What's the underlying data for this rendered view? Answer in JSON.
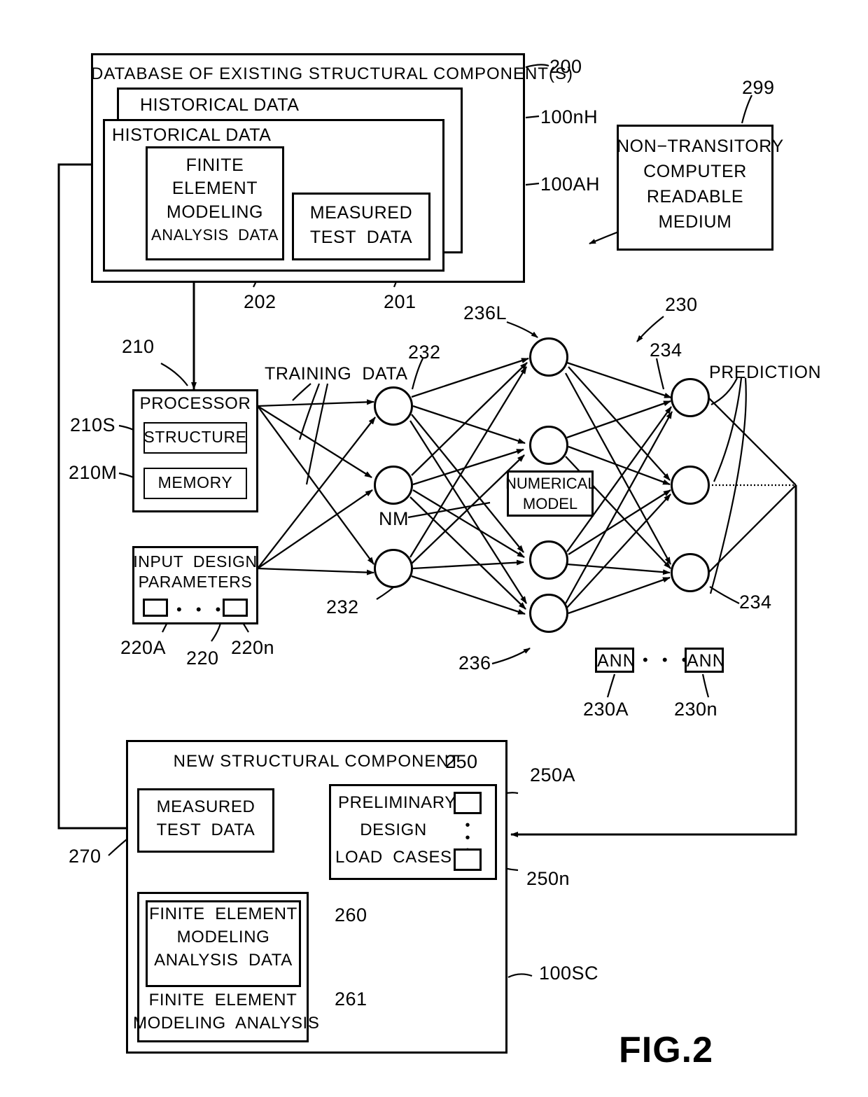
{
  "figure": {
    "title": "FIG.2",
    "type": "patent-flow-diagram"
  },
  "database": {
    "title": "DATABASE OF EXISTING STRUCTURAL COMPONENT(S)",
    "ref": "200",
    "historical_outer": {
      "title": "HISTORICAL DATA",
      "ref": "100nH"
    },
    "historical_inner": {
      "title": "HISTORICAL DATA",
      "ref": "100AH"
    },
    "fem_box": {
      "line1": "FINITE",
      "line2": "ELEMENT",
      "line3": "MODELING",
      "line4": "ANALYSIS  DATA",
      "ref": "202"
    },
    "measured_box": {
      "line1": "MEASURED",
      "line2": "TEST  DATA",
      "ref": "201"
    }
  },
  "medium": {
    "line1": "NON−TRANSITORY",
    "line2": "COMPUTER",
    "line3": "READABLE",
    "line4": "MEDIUM",
    "ref": "299"
  },
  "processor": {
    "title": "PROCESSOR",
    "ref": "210",
    "structure": {
      "label": "STRUCTURE",
      "ref": "210S"
    },
    "memory": {
      "label": "MEMORY",
      "ref": "210M"
    }
  },
  "input_params": {
    "line1": "INPUT  DESIGN",
    "line2": "PARAMETERS",
    "ref": "220",
    "first_ref": "220A",
    "last_ref": "220n",
    "ellipsis": "• • •"
  },
  "network": {
    "ref": "230",
    "training_data_label": "TRAINING  DATA",
    "prediction_label": "PREDICTION",
    "input_layer_ref": "232",
    "input_layer_ref2": "232",
    "hidden_layer_ref": "236",
    "hidden_layer_top_ref": "236L",
    "output_layer_ref": "234",
    "output_layer_ref2": "234",
    "numerical_model": {
      "line1": "NUMERICAL",
      "line2": "MODEL",
      "ref": "NM"
    },
    "ann_first": {
      "label": "ANN",
      "ref": "230A"
    },
    "ann_last": {
      "label": "ANN",
      "ref": "230n"
    },
    "ann_ellipsis": "• • •",
    "input_node_count": 3,
    "hidden_node_count": 4,
    "output_node_count": 3
  },
  "new_component": {
    "title": "NEW STRUCTURAL COMPONENT",
    "ref": "100SC",
    "measured_test_data": {
      "line1": "MEASURED",
      "line2": "TEST  DATA",
      "ref": "270"
    },
    "fem_analysis": {
      "inner_line1": "FINITE  ELEMENT",
      "inner_line2": "MODELING",
      "inner_line3": "ANALYSIS  DATA",
      "outer_line1": "FINITE  ELEMENT",
      "outer_line2": "MODELING  ANALYSIS",
      "inner_ref": "260",
      "outer_ref": "261"
    },
    "preliminary": {
      "line1": "PRELIMINARY",
      "line2": "DESIGN",
      "line3": "LOAD  CASES",
      "ref": "250",
      "first_ref": "250A",
      "last_ref": "250n"
    }
  }
}
